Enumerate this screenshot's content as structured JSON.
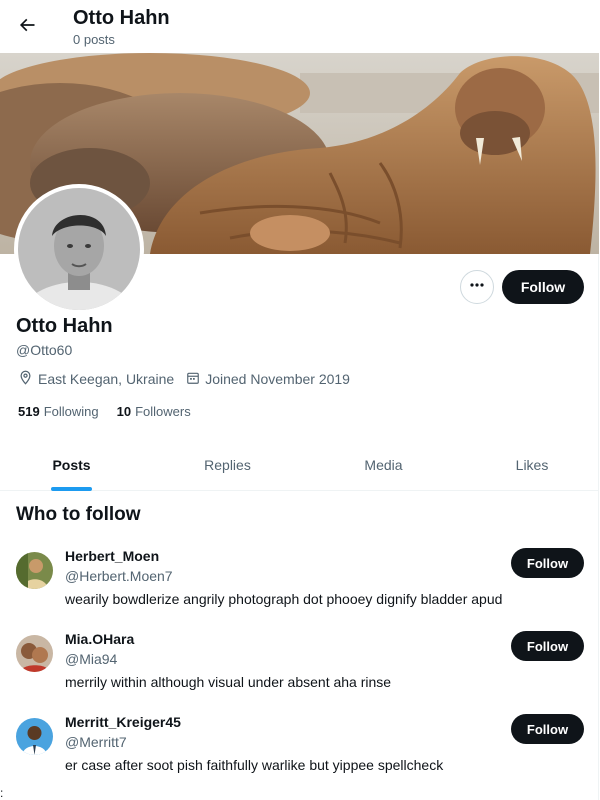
{
  "header": {
    "title": "Otto Hahn",
    "subtitle": "0 posts",
    "back_icon": "arrow-left-icon"
  },
  "profile": {
    "name": "Otto Hahn",
    "handle": "@Otto60",
    "location": "East Keegan, Ukraine",
    "joined": "Joined November 2019",
    "following_count": "519",
    "following_label": "Following",
    "followers_count": "10",
    "followers_label": "Followers",
    "follow_label": "Follow",
    "more_icon": "more-horizontal-icon"
  },
  "tabs": [
    {
      "label": "Posts",
      "active": true
    },
    {
      "label": "Replies",
      "active": false
    },
    {
      "label": "Media",
      "active": false
    },
    {
      "label": "Likes",
      "active": false
    }
  ],
  "who_to_follow": {
    "title": "Who to follow",
    "users": [
      {
        "name": "Herbert_Moen",
        "handle": "@Herbert.Moen7",
        "bio": "wearily bowdlerize angrily photograph dot phooey dignify bladder apud",
        "follow_label": "Follow"
      },
      {
        "name": "Mia.OHara",
        "handle": "@Mia94",
        "bio": "merrily within although visual under absent aha rinse",
        "follow_label": "Follow"
      },
      {
        "name": "Merritt_Kreiger45",
        "handle": "@Merritt7",
        "bio": "er case after soot pish faithfully warlike but yippee spellcheck",
        "follow_label": "Follow"
      }
    ]
  },
  "stray_text": ":",
  "colors": {
    "accent": "#1d9bf0",
    "text_primary": "#0f1419",
    "text_secondary": "#536471",
    "button_dark": "#0f1419"
  }
}
